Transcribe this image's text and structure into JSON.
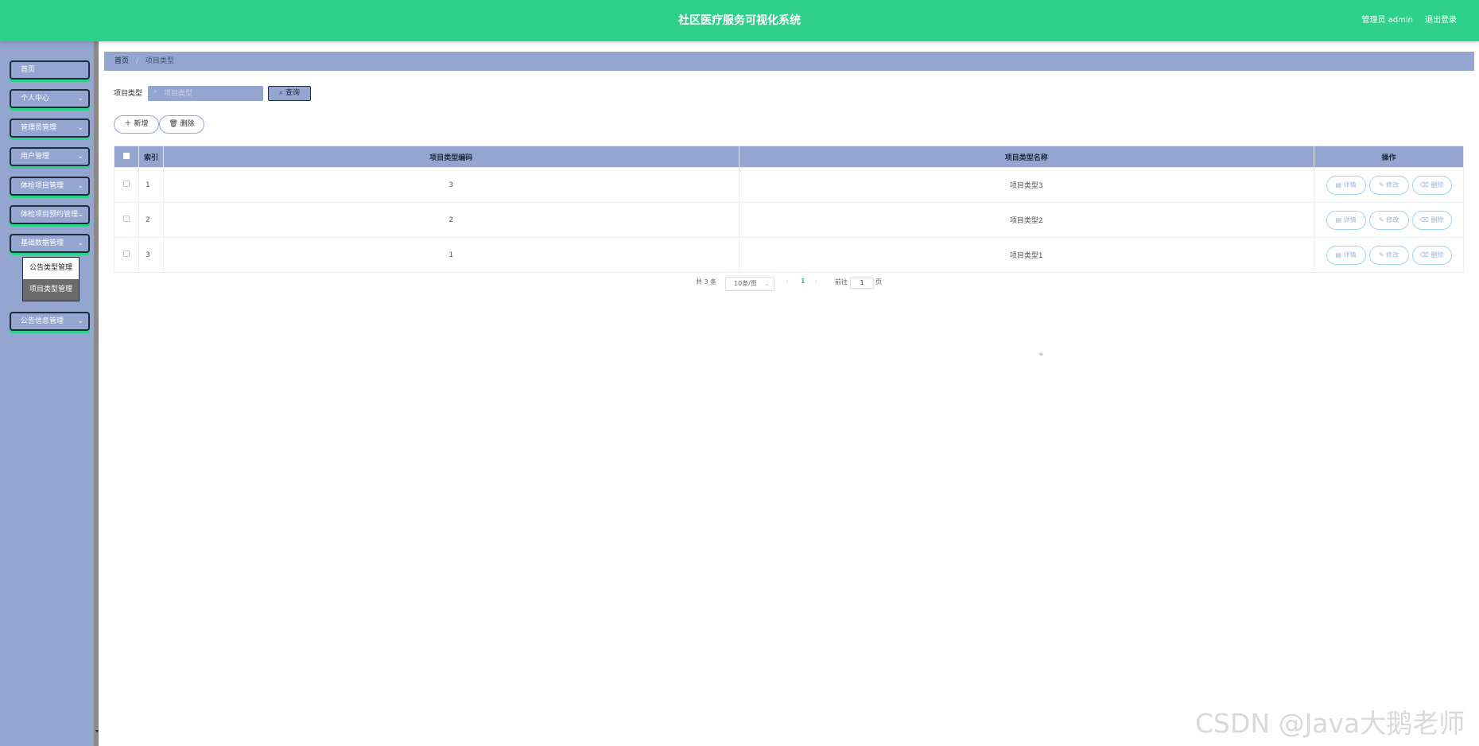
{
  "header": {
    "title": "社区医疗服务可视化系统",
    "user": "管理员 admin",
    "logout": "退出登录"
  },
  "sidebar": {
    "items": [
      {
        "label": "首页",
        "has_chevron": false
      },
      {
        "label": "个人中心",
        "has_chevron": true
      },
      {
        "label": "管理员管理",
        "has_chevron": true
      },
      {
        "label": "用户管理",
        "has_chevron": true
      },
      {
        "label": "体检项目管理",
        "has_chevron": true
      },
      {
        "label": "体检项目预约管理",
        "has_chevron": true
      },
      {
        "label": "基础数据管理",
        "has_chevron": true
      },
      {
        "label": "公告信息管理",
        "has_chevron": true
      }
    ],
    "submenu": [
      {
        "label": "公告类型管理",
        "active": false
      },
      {
        "label": "项目类型管理",
        "active": true
      }
    ]
  },
  "breadcrumb": {
    "home": "首页",
    "separator": "/",
    "current": "项目类型"
  },
  "search": {
    "label": "项目类型",
    "placeholder": "项目类型",
    "button": "查询"
  },
  "actions": {
    "add": "新增",
    "delete": "删除"
  },
  "table": {
    "columns": [
      "索引",
      "项目类型编码",
      "项目类型名称",
      "操作"
    ],
    "rows": [
      {
        "index": "1",
        "code": "3",
        "name": "项目类型3"
      },
      {
        "index": "2",
        "code": "2",
        "name": "项目类型2"
      },
      {
        "index": "3",
        "code": "1",
        "name": "项目类型1"
      }
    ],
    "row_actions": {
      "detail": "详情",
      "edit": "修改",
      "delete": "删除"
    }
  },
  "pagination": {
    "total": "共 3 条",
    "page_size": "10条/页",
    "current_page": "1",
    "goto_label": "前往",
    "goto_value": "1",
    "page_suffix": "页"
  },
  "watermark": "CSDN @Java大鹅老师",
  "colors": {
    "header": "#2ed18a",
    "accent": "#94a5cf",
    "dark": "#1f2a3c"
  }
}
